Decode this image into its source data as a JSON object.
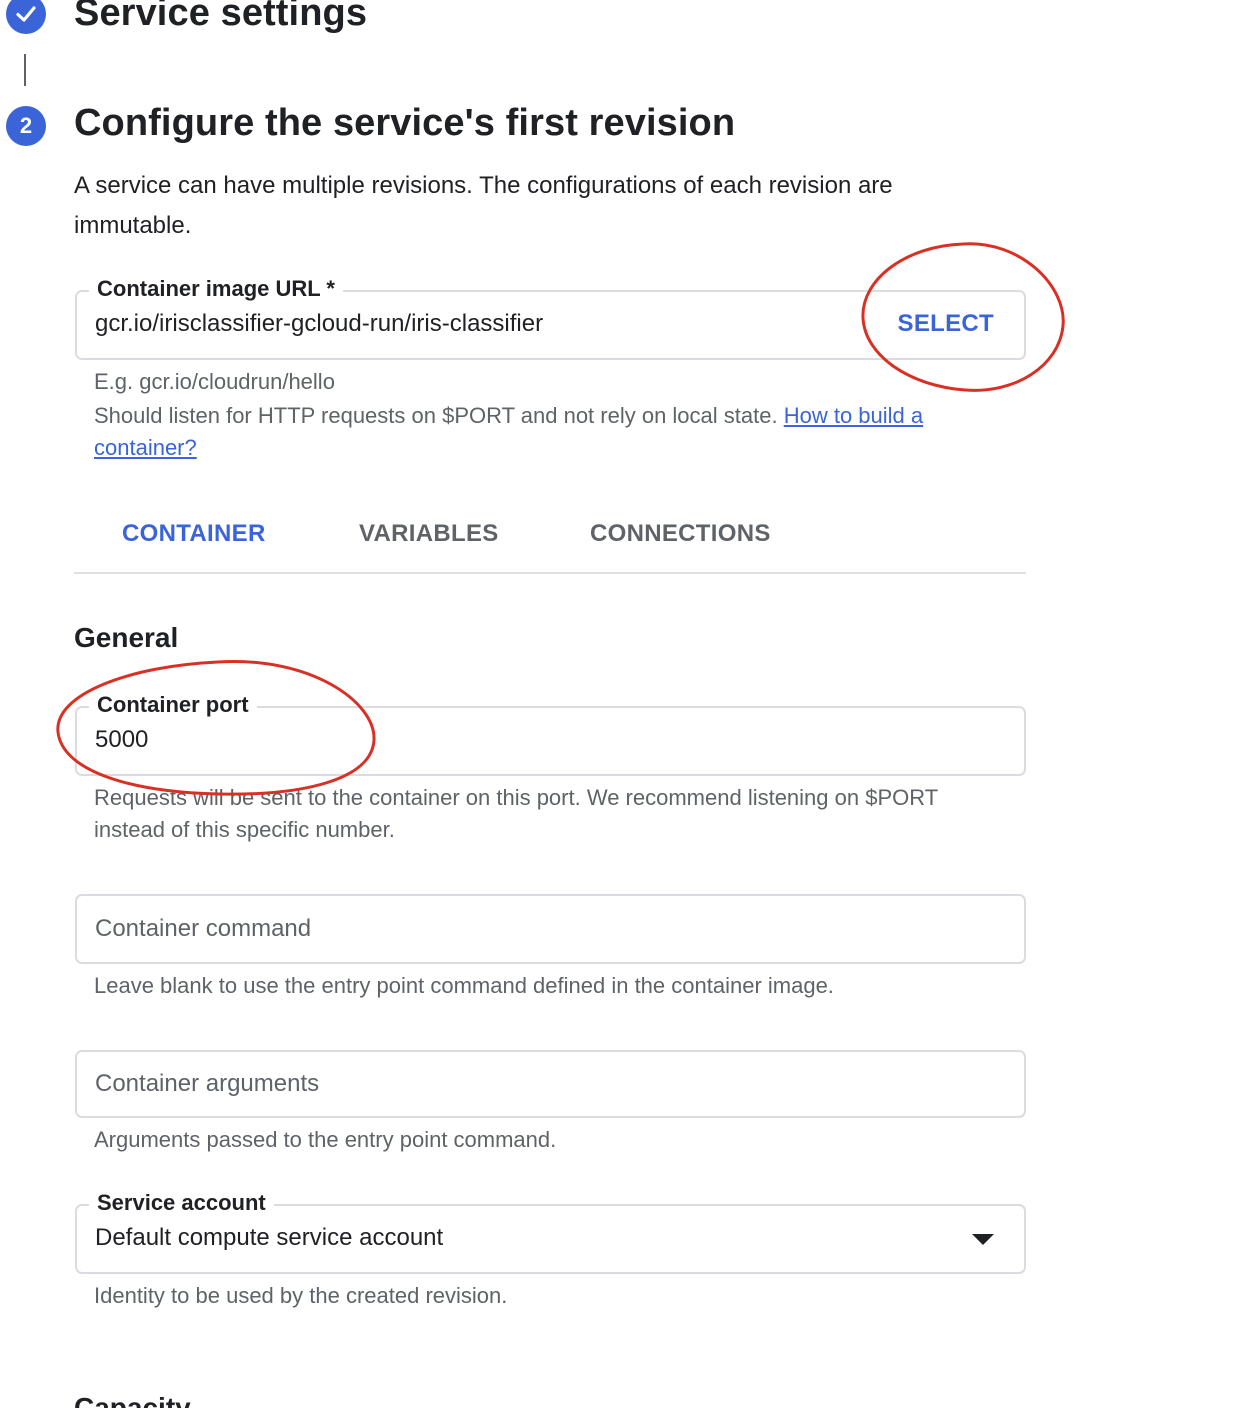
{
  "stepper": {
    "step1": {
      "title": "Service settings"
    },
    "step2": {
      "number": "2",
      "title": "Configure the service's first revision"
    }
  },
  "description": "A service can have multiple revisions. The configurations of each revision are immutable.",
  "image_url_field": {
    "label": "Container image URL *",
    "value": "gcr.io/irisclassifier-gcloud-run/iris-classifier",
    "select_label": "SELECT",
    "hint_example": "E.g. gcr.io/cloudrun/hello",
    "hint_text": "Should listen for HTTP requests on $PORT and not rely on local state.",
    "hint_link": "How to build a container?"
  },
  "tabs": [
    {
      "label": "CONTAINER",
      "active": true
    },
    {
      "label": "VARIABLES",
      "active": false
    },
    {
      "label": "CONNECTIONS",
      "active": false
    }
  ],
  "general": {
    "title": "General",
    "port_field": {
      "label": "Container port",
      "value": "5000",
      "hint": "Requests will be sent to the container on this port. We recommend listening on $PORT instead of this specific number."
    },
    "command_field": {
      "placeholder": "Container command",
      "hint": "Leave blank to use the entry point command defined in the container image."
    },
    "arguments_field": {
      "placeholder": "Container arguments",
      "hint": "Arguments passed to the entry point command."
    },
    "service_account_field": {
      "label": "Service account",
      "value": "Default compute service account",
      "hint": "Identity to be used by the created revision."
    }
  },
  "next_section": {
    "title": "Capacity"
  },
  "colors": {
    "primary": "#3a64d8",
    "text": "#202124",
    "secondary_text": "#5f6368",
    "border": "#dadce0",
    "annotation": "#d93025"
  }
}
